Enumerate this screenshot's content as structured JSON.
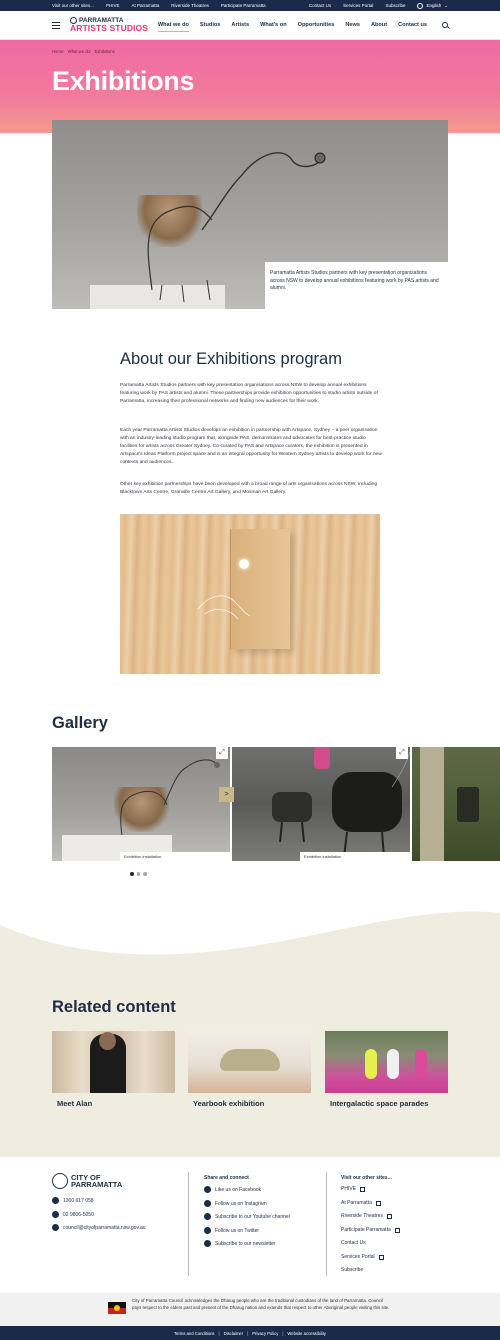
{
  "topbar": {
    "visit_label": "Visit our other sites...",
    "sites": [
      "PHIVE",
      "At Parramatta",
      "Riverside Theatres",
      "Participate Parramatta"
    ],
    "right_links": [
      "Contact Us",
      "Services Portal",
      "Subscribe"
    ],
    "language": "English"
  },
  "header": {
    "logo_line1": "PARRAMATTA",
    "logo_line2": "ARTISTS STUDIOS",
    "nav": [
      "What we do",
      "Studios",
      "Artists",
      "What's on",
      "Opportunities",
      "News",
      "About",
      "Contact us"
    ]
  },
  "breadcrumb": [
    "Home",
    "What we do",
    "Exhibitions"
  ],
  "page_title": "Exhibitions",
  "hero_caption": "Parramatta Artists Studios partners with key presentation organisations across NSW to develop annual exhibitions featuring work by PAS artists and alumni.",
  "about": {
    "title": "About our Exhibitions program",
    "p1": "Parramatta Artists Studios partners with key presentation organisations across NSW to develop annual exhibitions featuring work by PAS artists and alumni. These partnerships provide exhibition opportunities to studio artists outside of Parramatta, increasing their professional networks and finding new audiences for their work.",
    "p2": "Each year Parramatta Artists Studios develops an exhibition in partnership with Artspace, Sydney – a peer organisation with an industry-leading studio program that, alongside PAS, demonstrates and advocates for best-practice studio facilities for artists across Greater Sydney. Co-curated by PAS and Artspace curators, the exhibition is presented in Artspace's Ideas Platform project space and is an integral opportunity for Western Sydney artists to develop work for new contexts and audiences.",
    "p3": "Other key exhibition partnerships have been developed with a broad range of arts organisations across NSW, including Blacktown Arts Centre, Granville Centre Art Gallery, and Mosman Art Gallery."
  },
  "gallery": {
    "title": "Gallery",
    "captions": [
      "Exhibition installation",
      "Exhibition installation"
    ],
    "next_label": ">",
    "dots": 3,
    "active_dot": 0
  },
  "related": {
    "title": "Related content",
    "items": [
      "Meet Alan",
      "Yearbook exhibition",
      "Intergalactic space parades"
    ]
  },
  "footer": {
    "logo_line1": "CITY OF",
    "logo_line2": "PARRAMATTA",
    "phone1": "1300 617 058",
    "phone2": "02 9806-5050",
    "email": "council@cityofparramatta.nsw.gov.au",
    "share_title": "Share and connect",
    "share_items": [
      "Like us on Facebook",
      "Follow us on Instagram",
      "Subscribe to our Youtube channel",
      "Follow us on Twitter",
      "Subscribe to our newsletter"
    ],
    "sites_title": "Visit our other sites...",
    "site_items": [
      "PHIVE",
      "At Parramatta",
      "Riverside Theatres",
      "Participate Parramatta",
      "Contact Us",
      "Services Portal",
      "Subscribe"
    ],
    "acknowledgement": "City of Parramatta Council acknowledges the Dharug people who are the traditional custodians of the land of Parramatta. Council pays respect to the elders past and present of the Dharug nation and extends that respect to other Aboriginal people visiting this site.",
    "legal": [
      "Terms and Conditions",
      "Disclaimer",
      "Privacy Policy",
      "Website accessibility"
    ]
  },
  "colors": {
    "navy": "#1b2a4a",
    "pink": "#e2357f",
    "gold": "#c9b789",
    "beige": "#efece0"
  }
}
